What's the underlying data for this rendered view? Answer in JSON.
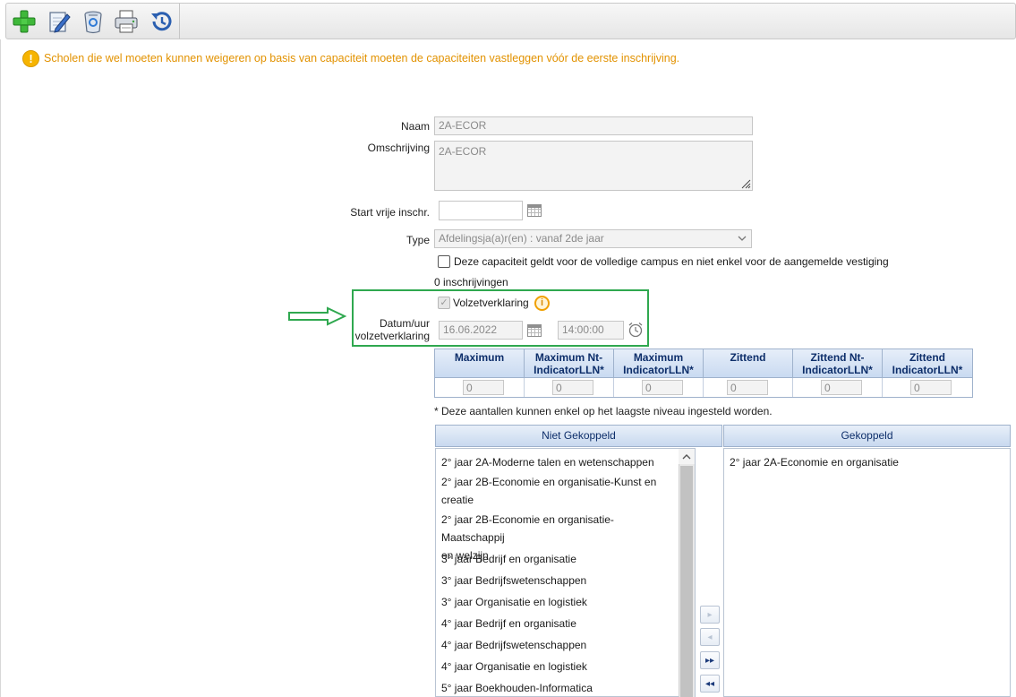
{
  "toolbar": {
    "buttons": [
      {
        "name": "add",
        "icon": "plus-icon"
      },
      {
        "name": "edit",
        "icon": "pencil-icon"
      },
      {
        "name": "delete",
        "icon": "recycle-bin-icon"
      },
      {
        "name": "print",
        "icon": "printer-icon"
      },
      {
        "name": "history",
        "icon": "history-icon"
      }
    ]
  },
  "warning": {
    "text": "Scholen die wel moeten kunnen weigeren op basis van capaciteit moeten de capaciteiten vastleggen vóór de eerste inschrijving.",
    "color": "#e29200"
  },
  "form": {
    "naam_label": "Naam",
    "naam_value": "2A-ECOR",
    "omschrijving_label": "Omschrijving",
    "omschrijving_value": "2A-ECOR",
    "start_label": "Start vrije inschr.",
    "start_value": "",
    "type_label": "Type",
    "type_value": "Afdelingsja(a)r(en) : vanaf 2de jaar",
    "campus_checkbox_label": "Deze capaciteit geldt voor de volledige campus en niet enkel voor de aangemelde vestiging",
    "campus_checked": false,
    "inschrijvingen_text": "0 inschrijvingen",
    "volzet_label": "Volzetverklaring",
    "volzet_checked": true,
    "datum_label_line1": "Datum/uur",
    "datum_label_line2": "volzetverklaring",
    "datum_value": "16.06.2022",
    "time_value": "14:00:00"
  },
  "capacity": {
    "headers": [
      [
        "Maximum",
        ""
      ],
      [
        "Maximum Nt-",
        "IndicatorLLN*"
      ],
      [
        "Maximum",
        "IndicatorLLN*"
      ],
      [
        "Zittend",
        ""
      ],
      [
        "Zittend Nt-",
        "IndicatorLLN*"
      ],
      [
        "Zittend",
        "IndicatorLLN*"
      ]
    ],
    "values": [
      "0",
      "0",
      "0",
      "0",
      "0",
      "0"
    ],
    "note": "*  Deze aantallen kunnen enkel op het laagste niveau ingesteld worden."
  },
  "lists": {
    "niet_gekoppeld_header": "Niet Gekoppeld",
    "gekoppeld_header": "Gekoppeld",
    "niet_gekoppeld": [
      [
        "2° jaar 2A-Moderne talen en wetenschappen"
      ],
      [
        "2° jaar 2B-Economie en organisatie-Kunst en",
        "creatie"
      ],
      [
        "2° jaar 2B-Economie en organisatie-Maatschappij",
        "en welzijn"
      ],
      [
        "3° jaar Bedrijf en organisatie"
      ],
      [
        "3° jaar Bedrijfswetenschappen"
      ],
      [
        "3° jaar Organisatie en logistiek"
      ],
      [
        "4° jaar Bedrijf en organisatie"
      ],
      [
        "4° jaar Bedrijfswetenschappen"
      ],
      [
        "4° jaar Organisatie en logistiek"
      ],
      [
        "5° jaar Boekhouden-Informatica"
      ]
    ],
    "gekoppeld": [
      "2° jaar 2A-Economie en organisatie"
    ]
  },
  "move_buttons": [
    {
      "icon": "move-right-icon",
      "glyph": "▸",
      "enabled": false
    },
    {
      "icon": "move-left-icon",
      "glyph": "◂",
      "enabled": false
    },
    {
      "icon": "move-all-right-icon",
      "glyph": "▸▸",
      "enabled": true
    },
    {
      "icon": "move-all-left-icon",
      "glyph": "◂◂",
      "enabled": true
    }
  ],
  "colors": {
    "highlight_box": "#2fa84f",
    "header_text": "#0d2e6a"
  }
}
